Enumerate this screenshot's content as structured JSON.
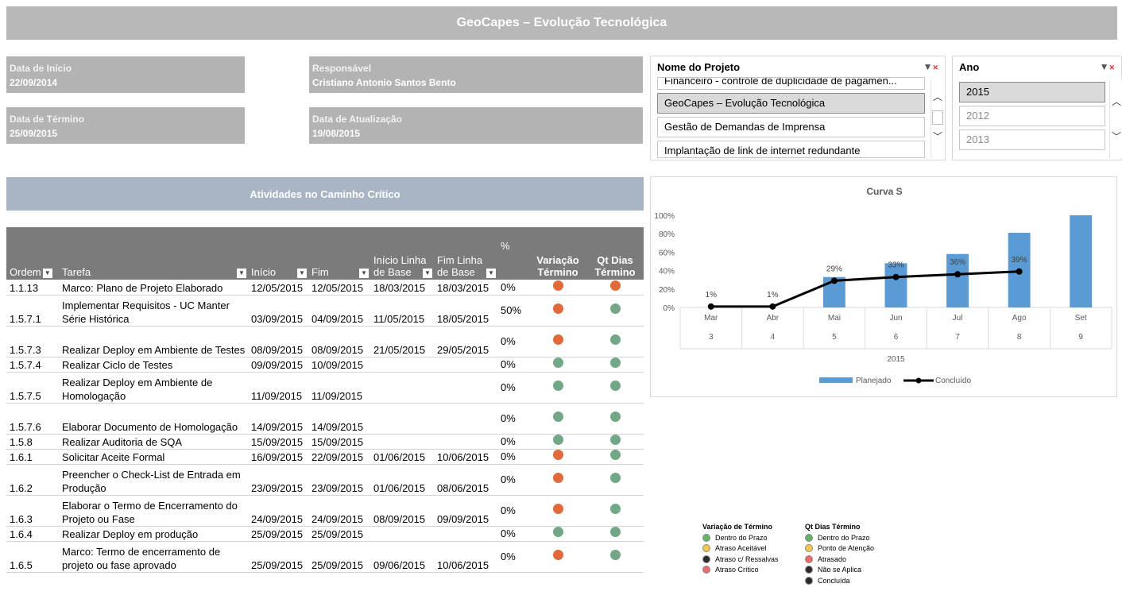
{
  "header": {
    "title": "GeoCapes – Evolução Tecnológica"
  },
  "info": {
    "start_label": "Data de Início",
    "start_value": "22/09/2014",
    "end_label": "Data de Término",
    "end_value": "25/09/2015",
    "owner_label": "Responsável",
    "owner_value": "Cristiano Antonio Santos Bento",
    "update_label": "Data de Atualização",
    "update_value": "19/08/2015"
  },
  "slicer_project": {
    "title": "Nome do Projeto",
    "items": [
      "Financeiro - controle de duplicidade de pagamen...",
      "GeoCapes – Evolução Tecnológica",
      "Gestão de Demandas de Imprensa",
      "Implantação de link de internet redundante"
    ]
  },
  "slicer_year": {
    "title": "Ano",
    "items": [
      "2015",
      "2012",
      "2013"
    ]
  },
  "critical_path": {
    "title": "Atividades no Caminho Crítico",
    "columns": {
      "ordem": "Ordem",
      "tarefa": "Tarefa",
      "inicio": "Início",
      "fim": "Fim",
      "inicio_base_1": "Início Linha",
      "inicio_base_2": "de Base",
      "fim_base_1": "Fim Linha",
      "fim_base_2": "de Base",
      "pct": "%",
      "var_1": "Variação",
      "var_2": "Término",
      "qt_1": "Qt Dias",
      "qt_2": "Término"
    },
    "rows": [
      {
        "ordem": "1.1.13",
        "tarefa": "Marco: Plano de Projeto Elaborado",
        "inicio": "12/05/2015",
        "fim": "12/05/2015",
        "ib": "18/03/2015",
        "fb": "18/03/2015",
        "pct": "0%",
        "var": "red",
        "qt": "red"
      },
      {
        "ordem": "1.5.7.1",
        "tarefa": "Implementar Requisitos - UC Manter Série Histórica",
        "inicio": "03/09/2015",
        "fim": "04/09/2015",
        "ib": "11/05/2015",
        "fb": "18/05/2015",
        "pct": "50%",
        "var": "red",
        "qt": "green"
      },
      {
        "ordem": "1.5.7.3",
        "tarefa": "Realizar Deploy em Ambiente de Testes",
        "inicio": "08/09/2015",
        "fim": "08/09/2015",
        "ib": "21/05/2015",
        "fb": "29/05/2015",
        "pct": "0%",
        "var": "red",
        "qt": "green"
      },
      {
        "ordem": "1.5.7.4",
        "tarefa": "Realizar Ciclo de Testes",
        "inicio": "09/09/2015",
        "fim": "10/09/2015",
        "ib": "",
        "fb": "",
        "pct": "0%",
        "var": "green",
        "qt": "green"
      },
      {
        "ordem": "1.5.7.5",
        "tarefa": "Realizar Deploy em Ambiente de Homologação",
        "inicio": "11/09/2015",
        "fim": "11/09/2015",
        "ib": "",
        "fb": "",
        "pct": "0%",
        "var": "green",
        "qt": "green"
      },
      {
        "ordem": "1.5.7.6",
        "tarefa": "Elaborar Documento de Homologação",
        "inicio": "14/09/2015",
        "fim": "14/09/2015",
        "ib": "",
        "fb": "",
        "pct": "0%",
        "var": "green",
        "qt": "green"
      },
      {
        "ordem": "1.5.8",
        "tarefa": "Realizar Auditoria de SQA",
        "inicio": "15/09/2015",
        "fim": "15/09/2015",
        "ib": "",
        "fb": "",
        "pct": "0%",
        "var": "green",
        "qt": "green"
      },
      {
        "ordem": "1.6.1",
        "tarefa": "Solicitar Aceite Formal",
        "inicio": "16/09/2015",
        "fim": "22/09/2015",
        "ib": "01/06/2015",
        "fb": "10/06/2015",
        "pct": "0%",
        "var": "red",
        "qt": "green"
      },
      {
        "ordem": "1.6.2",
        "tarefa": "Preencher o Check-List de Entrada em Produção",
        "inicio": "23/09/2015",
        "fim": "23/09/2015",
        "ib": "01/06/2015",
        "fb": "08/06/2015",
        "pct": "0%",
        "var": "red",
        "qt": "green"
      },
      {
        "ordem": "1.6.3",
        "tarefa": "Elaborar o Termo de Encerramento do Projeto ou Fase",
        "inicio": "24/09/2015",
        "fim": "24/09/2015",
        "ib": "08/09/2015",
        "fb": "09/09/2015",
        "pct": "0%",
        "var": "red",
        "qt": "green"
      },
      {
        "ordem": "1.6.4",
        "tarefa": "Realizar Deploy em produção",
        "inicio": "25/09/2015",
        "fim": "25/09/2015",
        "ib": "",
        "fb": "",
        "pct": "0%",
        "var": "green",
        "qt": "green"
      },
      {
        "ordem": "1.6.5",
        "tarefa": "Marco: Termo de encerramento de projeto ou fase aprovado",
        "inicio": "25/09/2015",
        "fim": "25/09/2015",
        "ib": "09/06/2015",
        "fb": "10/06/2015",
        "pct": "0%",
        "var": "red",
        "qt": "green"
      }
    ]
  },
  "colors": {
    "red": "#e06a3a",
    "green": "#72a888",
    "bar": "#5b9bd5",
    "line": "#000000"
  },
  "chart_data": {
    "type": "bar",
    "title": "Curva S",
    "categories": [
      "Mar",
      "Abr",
      "Mai",
      "Jun",
      "Jul",
      "Ago",
      "Set"
    ],
    "sub_categories": [
      "3",
      "4",
      "5",
      "6",
      "7",
      "8",
      "9"
    ],
    "group_label": "2015",
    "ylim": [
      0,
      100
    ],
    "y_ticks": [
      "0%",
      "20%",
      "40%",
      "60%",
      "80%",
      "100%"
    ],
    "series": [
      {
        "name": "Planejado",
        "kind": "bar",
        "values": [
          0,
          0,
          33,
          48,
          58,
          81,
          100
        ]
      },
      {
        "name": "Concluído",
        "kind": "line",
        "values": [
          1,
          1,
          29,
          33,
          36,
          39,
          null
        ]
      }
    ],
    "data_labels": [
      "1%",
      "1%",
      "29%",
      "33%",
      "36%",
      "39%",
      ""
    ]
  },
  "legend": {
    "var_title": "Variação de Término",
    "var_items": [
      {
        "label": "Dentro do Prazo",
        "color": "#5fb56b"
      },
      {
        "label": "Atraso Aceitável",
        "color": "#f5c84c"
      },
      {
        "label": "Atraso c/ Ressalvas",
        "color": "#2b2b2b"
      },
      {
        "label": "Atraso Crítico",
        "color": "#ec6a6a"
      }
    ],
    "qt_title": "Qt Dias Término",
    "qt_items": [
      {
        "label": "Dentro do Prazo",
        "color": "#5fb56b"
      },
      {
        "label": "Ponto de Atenção",
        "color": "#f5c84c"
      },
      {
        "label": "Atrasado",
        "color": "#ec6a6a"
      },
      {
        "label": "Não se Aplica",
        "color": "#2b2b2b"
      },
      {
        "label": "Concluída",
        "color": "#2b2b2b"
      }
    ]
  }
}
